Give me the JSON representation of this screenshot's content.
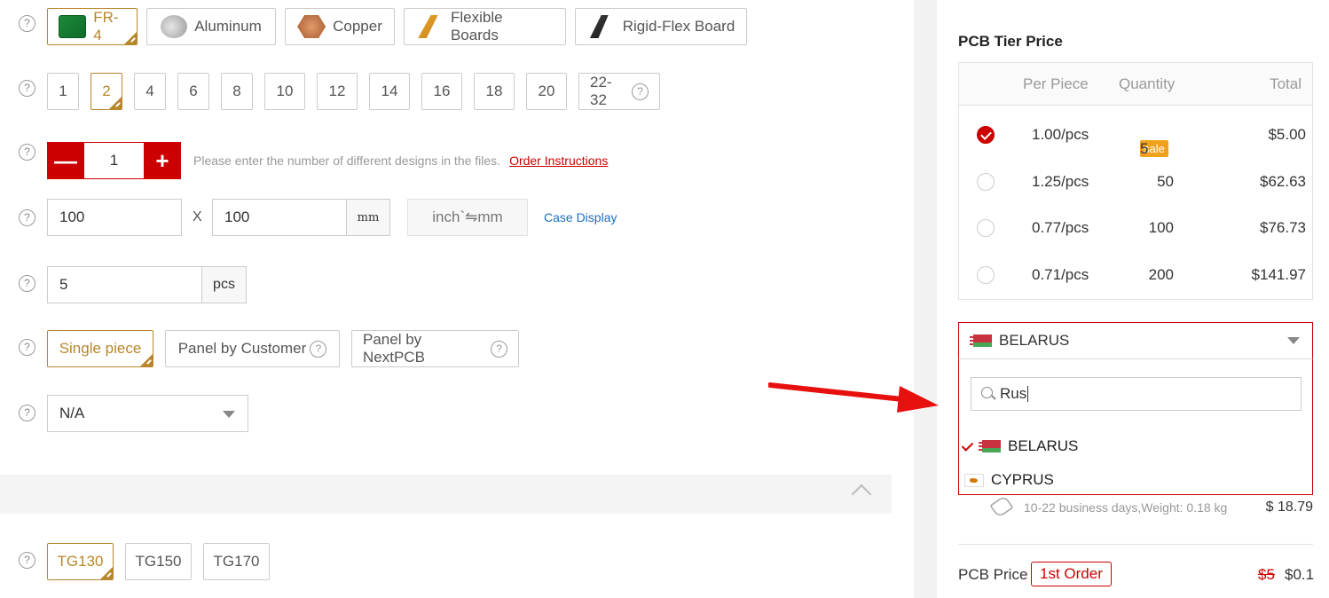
{
  "materials": [
    "FR-4",
    "Aluminum",
    "Copper",
    "Flexible Boards",
    "Rigid-Flex Board"
  ],
  "layers": [
    "1",
    "2",
    "4",
    "6",
    "8",
    "10",
    "12",
    "14",
    "16",
    "18",
    "20",
    "22-32"
  ],
  "designs": {
    "value": "1",
    "hint": "Please enter the number of different designs in the files.",
    "link": "Order Instructions"
  },
  "dimensions": {
    "x": "100",
    "sep": "X",
    "y": "100",
    "unit": "mm",
    "switch": "inch`⇋mm",
    "case_link": "Case Display"
  },
  "quantity": {
    "value": "5",
    "unit": "pcs"
  },
  "delivery": [
    "Single piece",
    "Panel by Customer",
    "Panel by NextPCB"
  ],
  "select_value": "N/A",
  "tg": [
    "TG130",
    "TG150",
    "TG170"
  ],
  "help_mark": "?",
  "tier": {
    "title": "PCB Tier Price",
    "headers": [
      "Per Piece",
      "Quantity",
      "Total"
    ],
    "rows": [
      {
        "per": "1.00/pcs",
        "qty": "5",
        "total": "$5.00",
        "sale": "sale"
      },
      {
        "per": "1.25/pcs",
        "qty": "50",
        "total": "$62.63"
      },
      {
        "per": "0.77/pcs",
        "qty": "100",
        "total": "$76.73"
      },
      {
        "per": "0.71/pcs",
        "qty": "200",
        "total": "$141.97"
      }
    ]
  },
  "country": {
    "selected": "BELARUS",
    "search": "Rus",
    "options": [
      "BELARUS",
      "CYPRUS"
    ]
  },
  "shipping": {
    "text": "10-22 business days,Weight: 0.18 kg",
    "price": "$ 18.79"
  },
  "pcb_price": {
    "label": "PCB Price",
    "badge": "1st Order",
    "old": "$5",
    "new": "$0.1"
  },
  "colors": {
    "accent": "#c00000",
    "gold": "#b8862b",
    "sale": "#f0a21a",
    "link": "#1a6fc9"
  }
}
